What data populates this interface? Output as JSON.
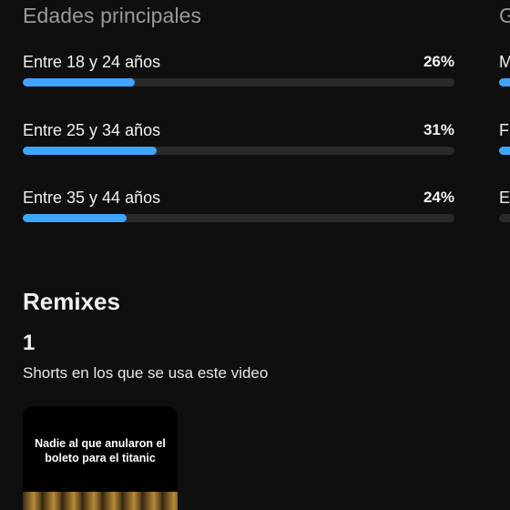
{
  "ages": {
    "title": "Edades principales",
    "rows": [
      {
        "label": "Entre 18 y 24 años",
        "percent": "26%",
        "value": 26
      },
      {
        "label": "Entre 25 y 34 años",
        "percent": "31%",
        "value": 31
      },
      {
        "label": "Entre 35 y 44 años",
        "percent": "24%",
        "value": 24
      }
    ]
  },
  "next_section": {
    "title_fragment": "G",
    "rows": [
      {
        "label_fragment": "M"
      },
      {
        "label_fragment": "F"
      },
      {
        "label_fragment": "E"
      }
    ]
  },
  "remixes": {
    "title": "Remixes",
    "count": "1",
    "description": "Shorts en los que se usa este video",
    "shorts": [
      {
        "caption": "Nadie al que anularon el boleto para el titanic"
      }
    ]
  },
  "colors": {
    "accent": "#3ea6ff",
    "track": "#2a2a2a",
    "background": "#0f0f0f"
  }
}
